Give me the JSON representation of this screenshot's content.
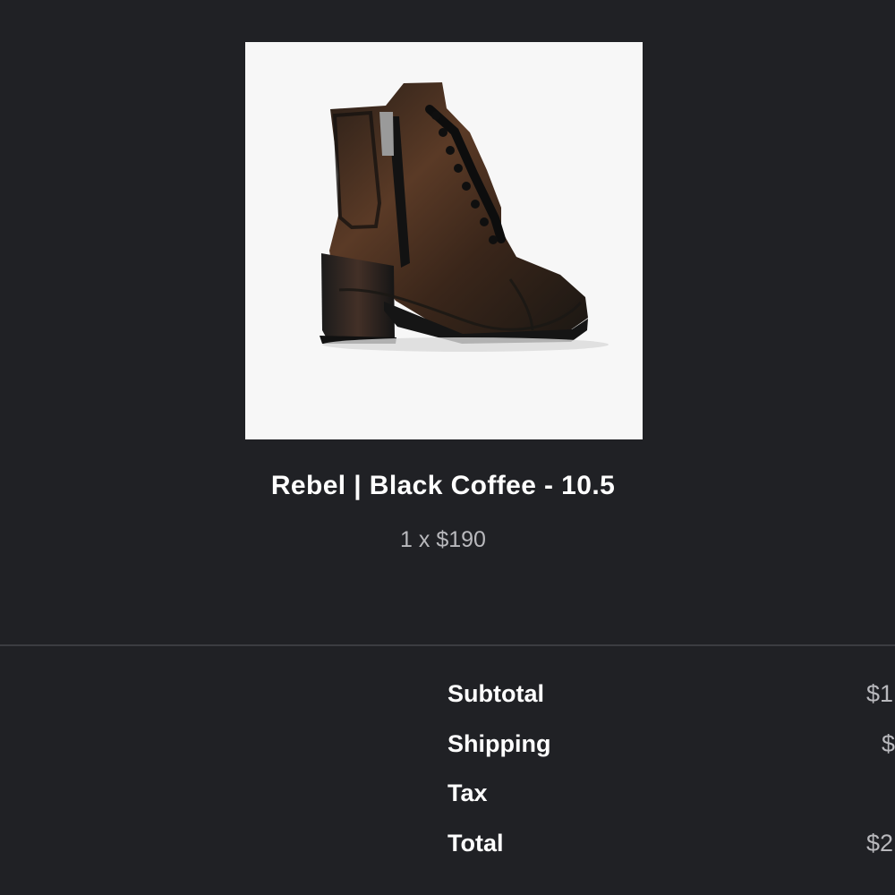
{
  "order_item": {
    "image_alt": "Rebel boot in Black Coffee",
    "title": "Rebel | Black Coffee - 10.5",
    "quantity_price": "1 x $190"
  },
  "order_summary": {
    "subtotal_label": "Subtotal",
    "subtotal_value": "$1",
    "shipping_label": "Shipping",
    "shipping_value": "$",
    "tax_label": "Tax",
    "total_label": "Total",
    "total_value": "$2"
  },
  "colors": {
    "background": "#202125",
    "text": "#ffffff",
    "muted_text": "#b9b9bd",
    "divider": "#3b3c41",
    "image_background": "#f7f7f7"
  }
}
